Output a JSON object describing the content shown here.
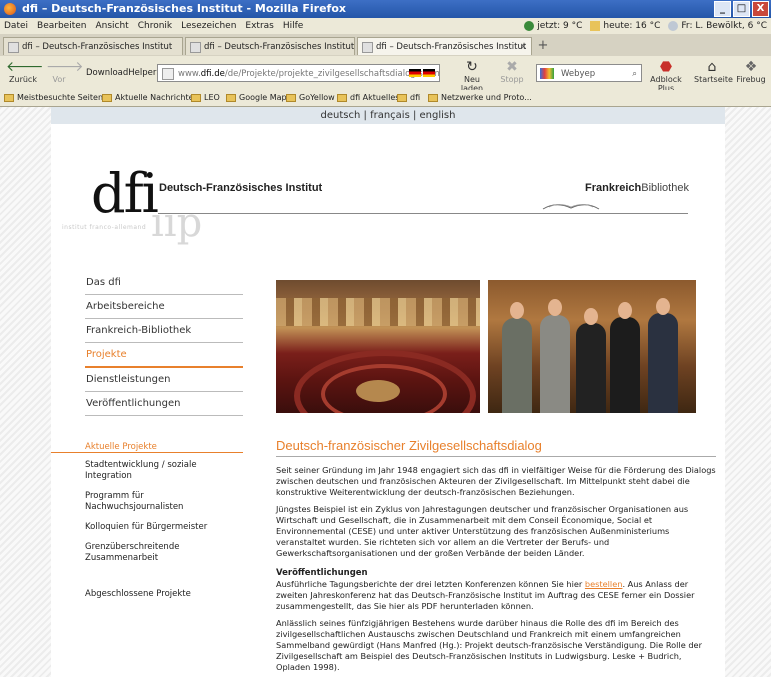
{
  "window": {
    "title": "dfi – Deutsch-Französisches Institut - Mozilla Firefox",
    "minimize": "_",
    "maximize": "□",
    "close": "X"
  },
  "menubar": {
    "items": [
      "Datei",
      "Bearbeiten",
      "Ansicht",
      "Chronik",
      "Lesezeichen",
      "Extras",
      "Hilfe"
    ],
    "weather": [
      "jetzt: 9 °C",
      "heute: 16 °C",
      "Fr: L. Bewölkt, 6 °C"
    ]
  },
  "tabs": [
    {
      "label": "dfi – Deutsch-Französisches Institut"
    },
    {
      "label": "dfi – Deutsch-Französisches Institut"
    },
    {
      "label": "dfi – Deutsch-Französisches Institut",
      "active": true
    }
  ],
  "tab_close": "×",
  "new_tab": "+",
  "navbar": {
    "back": "Zurück",
    "forward": "Vor",
    "downloadhelper": "DownloadHelper",
    "url_prefix": "www.",
    "url_site": "dfi.de",
    "url_path": "/de/Projekte/projekte_zivilgesellschaftsdialog.shtm",
    "reload": "Neu laden",
    "stop": "Stopp",
    "search_engine": "Webyep",
    "adblock": "Adblock Plus",
    "home": "Startseite",
    "firebug": "Firebug"
  },
  "bookmarks": [
    "Meistbesuchte Seiten",
    "Aktuelle Nachrichten",
    "LEO",
    "Google Maps",
    "GoYellow",
    "dfi Aktuelles",
    "dfi",
    "Netzwerke und Proto..."
  ],
  "page": {
    "languages": "deutsch | français | english",
    "logo_text": "dfi",
    "logo_subtitle": "Deutsch-Französisches Institut",
    "logo_ghost": "ııp",
    "logo_tagline": "institut franco-allemand",
    "fb_bold": "Frankreich",
    "fb_rest": "Bibliothek",
    "nav": [
      {
        "label": "Das dfi"
      },
      {
        "label": "Arbeitsbereiche"
      },
      {
        "label": "Frankreich-Bibliothek"
      },
      {
        "label": "Projekte",
        "active": true
      },
      {
        "label": "Dienstleistungen"
      },
      {
        "label": "Veröffentlichungen"
      }
    ],
    "subnav_active": "Aktuelle Projekte",
    "subnav": [
      "Stadtentwicklung / soziale Integration",
      "Programm für Nachwuchsjournalisten",
      "Kolloquien für Bürgermeister",
      "Grenzüberschreitende Zusammenarbeit"
    ],
    "subnav_closed": "Abgeschlossene Projekte",
    "heading": "Deutsch-französischer Zivilgesellschaftsdialog",
    "p1": "Seit seiner Gründung im Jahr 1948 engagiert sich das dfi in vielfältiger Weise für die Förderung des Dialogs zwischen deutschen und französischen Akteuren der Zivilgesellschaft. Im Mittelpunkt steht dabei die konstruktive Weiterentwicklung der deutsch-französischen Beziehungen.",
    "p2": "Jüngstes Beispiel ist ein Zyklus von Jahrestagungen deutscher und französischer Organisationen aus Wirtschaft und Gesellschaft, die in Zusammenarbeit mit dem Conseil Économique, Social et Environnemental (CESE) und unter aktiver Unterstützung des französischen Außenministeriums veranstaltet wurden. Sie richteten sich vor allem an die Vertreter der Berufs- und Gewerkschaftsorganisationen und der großen Verbände der beiden Länder.",
    "pub_heading": "Veröffentlichungen",
    "p3_before": "Ausführliche Tagungsberichte der drei letzten Konferenzen können Sie hier ",
    "p3_link": "bestellen",
    "p3_after": ". Aus Anlass der zweiten Jahreskonferenz hat das Deutsch-Französische Institut im Auftrag des CESE ferner ein Dossier zusammengestellt, das Sie hier als PDF herunterladen können.",
    "p4": "Anlässlich seines fünfzigjährigen Bestehens wurde darüber hinaus die Rolle des dfi im Bereich des zivilgesellschaftlichen Austauschs zwischen Deutschland und Frankreich mit einem umfangreichen Sammelband gewürdigt (Hans Manfred (Hg.): Projekt deutsch-französische Verständigung. Die Rolle der Zivilgesellschaft am Beispiel des Deutsch-Französischen Instituts in Ludwigsburg. Leske + Budrich, Opladen 1998)."
  }
}
